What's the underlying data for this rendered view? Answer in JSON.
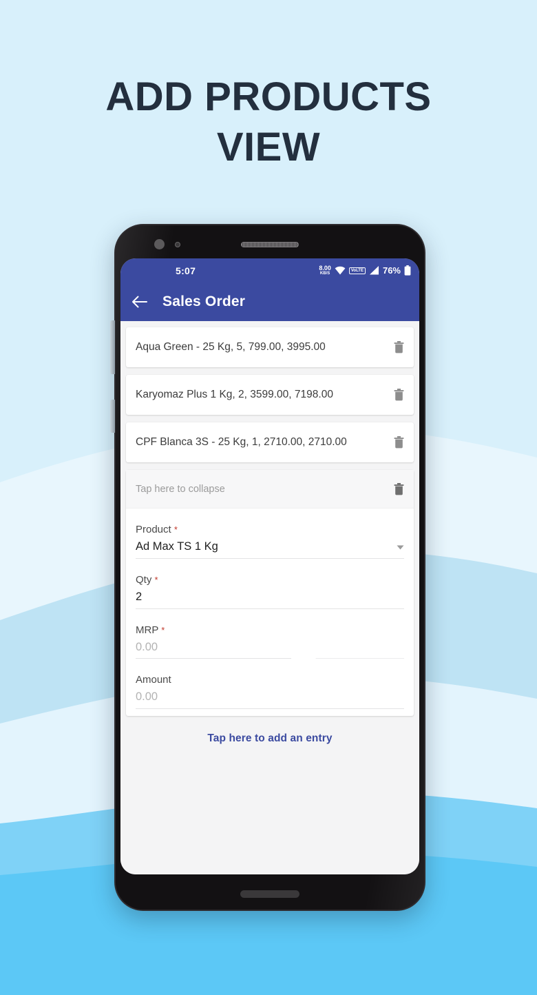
{
  "promo": {
    "line1": "ADD PRODUCTS",
    "line2": "VIEW",
    "title_color": "#232f3e"
  },
  "theme": {
    "primary": "#3b4aa0",
    "screen_bg": "#f4f4f5",
    "card_bg": "#ffffff",
    "required_marker": "#c0392b",
    "link": "#3b4aa0",
    "bg_wave_1": "#ffffff",
    "bg_wave_2": "#d8f0fb",
    "bg_wave_3": "#b3def4",
    "bg_wave_4": "#7ed2f7",
    "bg_wave_5": "#5cc8f6"
  },
  "statusbar": {
    "time": "5:07",
    "data_rate_value": "8.00",
    "data_rate_unit": "KB/S",
    "wifi_icon": "wifi-icon",
    "volte_label": "VoLTE",
    "signal_icon": "signal-icon",
    "battery_percent": "76%",
    "battery_icon": "battery-icon"
  },
  "appbar": {
    "back_icon": "back-arrow-icon",
    "title": "Sales Order"
  },
  "product_rows": [
    {
      "text": "Aqua Green - 25 Kg, 5, 799.00, 3995.00",
      "delete_icon": "trash-icon"
    },
    {
      "text": "Karyomaz Plus 1 Kg, 2, 3599.00, 7198.00",
      "delete_icon": "trash-icon"
    },
    {
      "text": "CPF Blanca 3S - 25 Kg, 1, 2710.00, 2710.00",
      "delete_icon": "trash-icon"
    }
  ],
  "expanded_entry": {
    "collapse_label": "Tap here to collapse",
    "delete_icon": "trash-icon",
    "fields": [
      {
        "label": "Product",
        "required": "*",
        "value": "Ad Max TS 1 Kg",
        "is_placeholder": false,
        "control": "dropdown"
      },
      {
        "label": "Qty",
        "required": "*",
        "value": "2",
        "is_placeholder": false,
        "control": "text"
      },
      {
        "label": "MRP",
        "required": "*",
        "value": "0.00",
        "is_placeholder": true,
        "control": "text"
      },
      {
        "label": "Amount",
        "required": "",
        "value": "0.00",
        "is_placeholder": true,
        "control": "text"
      }
    ]
  },
  "add_entry": {
    "label": "Tap here to add an entry"
  }
}
